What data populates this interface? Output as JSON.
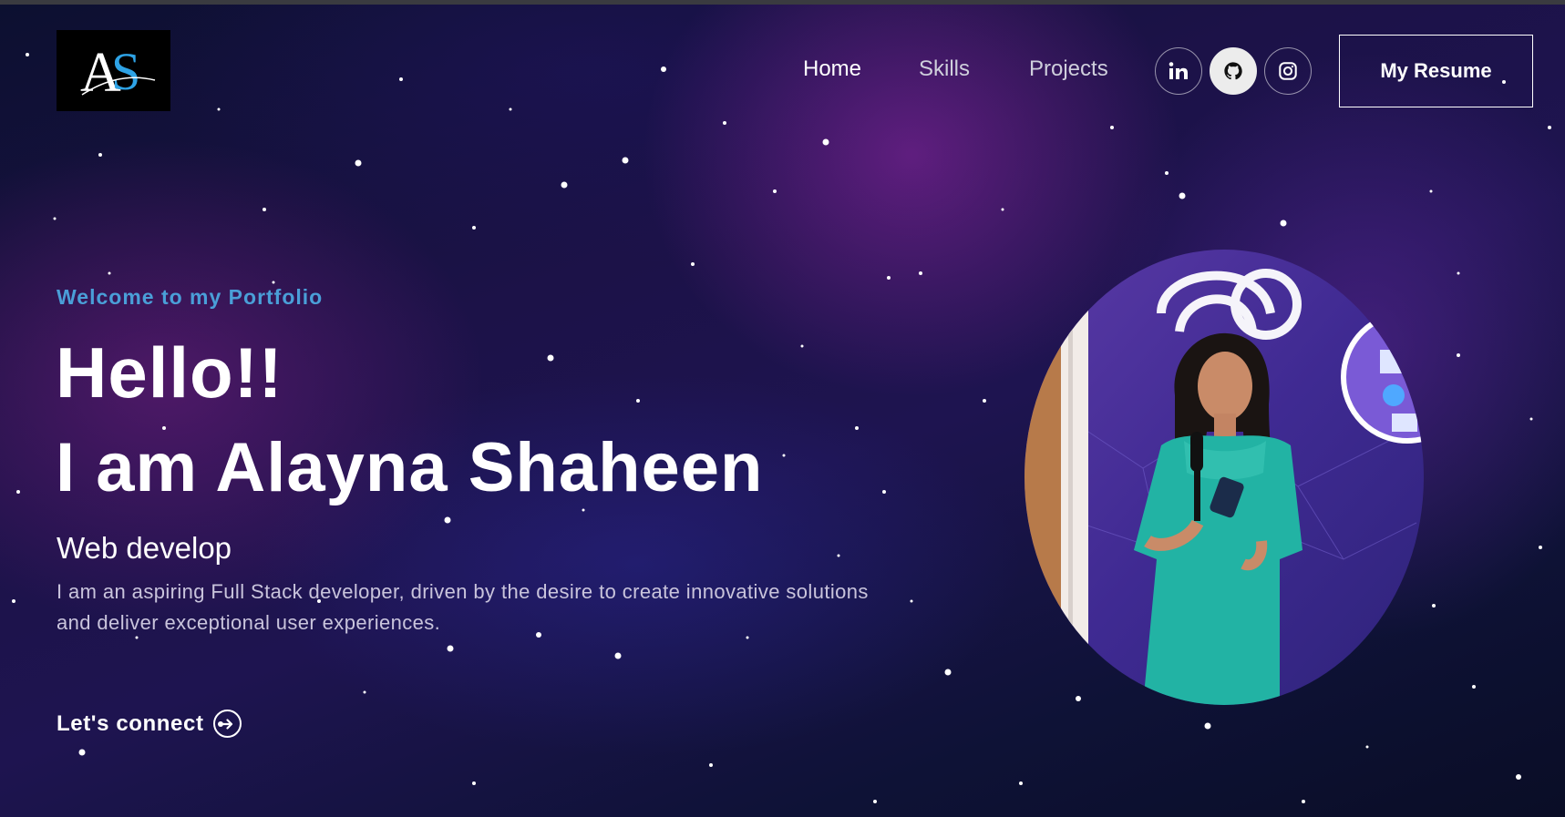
{
  "header": {
    "logo_text": "AS",
    "nav": [
      {
        "label": "Home"
      },
      {
        "label": "Skills"
      },
      {
        "label": "Projects"
      }
    ],
    "social": [
      {
        "icon": "linkedin-icon"
      },
      {
        "icon": "github-icon"
      },
      {
        "icon": "instagram-icon"
      }
    ],
    "resume_label": "My Resume"
  },
  "hero": {
    "tagline": "Welcome to my Portfolio",
    "greeting": "Hello!!",
    "name_line": "I am Alayna Shaheen",
    "role": "Web develop",
    "description": "I am an aspiring Full Stack developer, driven by the desire to create innovative solutions and deliver exceptional user experiences.",
    "connect_label": "Let's connect",
    "connect_icon": "arrow-right-circle-icon"
  },
  "portrait": {
    "icon": "profile-photo"
  },
  "colors": {
    "accent": "#4a9fd8",
    "logo_blue": "#2ea3e6",
    "dress": "#22b3a4",
    "background": "#1c1248"
  }
}
